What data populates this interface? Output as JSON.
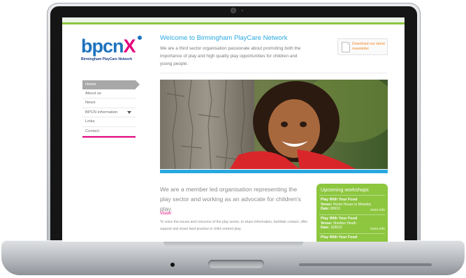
{
  "site": {
    "logo_word": "bpcn",
    "logo_mark": "X",
    "logo_subtitle": "Birmingham PlayCare Network",
    "welcome_title": "Welcome to Birmingham PlayCare Network",
    "welcome_text": "We are a third sector organisation passionate about promoting both the importance of play and high quality play opportunities for children and young people.",
    "newsletter_label": "Download our latest newsletter"
  },
  "nav": {
    "items": [
      {
        "label": "Home"
      },
      {
        "label": "About us"
      },
      {
        "label": "News"
      },
      {
        "label": "BPCN information"
      },
      {
        "label": "Links"
      },
      {
        "label": "Contact"
      }
    ]
  },
  "content": {
    "mission": "We are a member led organisation representing the play sector and working as an advocate for children's play.",
    "vision_title": "Vision",
    "vision_text": "To voice the issues and concerns of the play sector, to share information, facilitate contact, offer support and share best practice in child centred play."
  },
  "workshops": {
    "title": "Upcoming workshops",
    "items": [
      {
        "name": "Play With Your Food",
        "venue_label": "Venue:",
        "venue": "Home House in Moseley",
        "date_label": "Date:",
        "date": "8/8/10",
        "more": "more info"
      },
      {
        "name": "Play With Your Food",
        "venue_label": "Venue:",
        "venue": "Sheldon Heath",
        "date_label": "Date:",
        "date": "10/8/10",
        "more": "more info"
      },
      {
        "name": "Play With Your Food",
        "venue_label": "",
        "venue": "",
        "date_label": "",
        "date": "",
        "more": ""
      }
    ]
  },
  "colors": {
    "accent_green": "#8dc63f",
    "accent_blue": "#29a8e0",
    "accent_pink": "#e6007e",
    "logo_blue": "#1e73be"
  }
}
